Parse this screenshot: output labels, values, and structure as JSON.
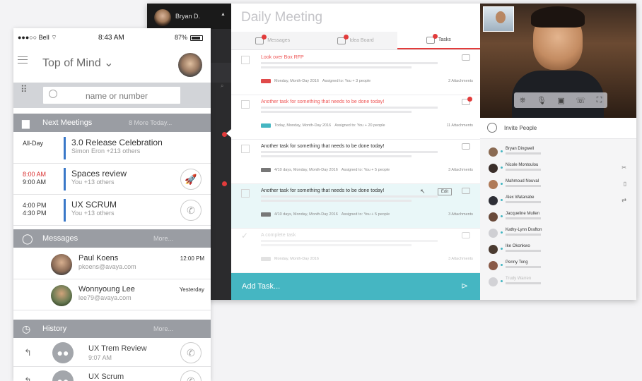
{
  "desktop": {
    "user": {
      "name": "Bryan D."
    },
    "title": "Daily Meeting",
    "tabs": [
      {
        "label": "Messages",
        "active": false
      },
      {
        "label": "Idea Board",
        "active": false
      },
      {
        "label": "Tasks",
        "active": true
      }
    ],
    "tasks": [
      {
        "title": "Look over Box RFP",
        "red": true,
        "meta": "Monday, Month-Day 2016",
        "assigned": "Assigned to: You + 3 people",
        "attachments": "2 Attachments"
      },
      {
        "title": "Another task for something that needs to be done today!",
        "red": true,
        "meta": "Today, Monday, Month-Day 2016",
        "assigned": "Assigned to: You + 20 people",
        "attachments": "11 Attachments"
      },
      {
        "title": "Another task for something that needs to be done today!",
        "red": false,
        "meta": "4/10 days, Monday, Month-Day 2016",
        "assigned": "Assigned to: You + 5 people",
        "attachments": "3 Attachments"
      },
      {
        "title": "Another task for something that needs to be done today!",
        "red": false,
        "meta": "4/10 days, Monday, Month-Day 2016",
        "assigned": "Assigned to: You + 5 people",
        "attachments": "3 Attachments",
        "edit_label": "Edit"
      },
      {
        "title": "A complete task",
        "red": false,
        "meta": "Monday, Month-Day 2016",
        "assigned": "",
        "attachments": "3 Attachments"
      }
    ],
    "add_task_label": "Add Task...",
    "invite_label": "Invite People",
    "participants": [
      {
        "name": "Bryan Dingwell",
        "color": "#8a6a52",
        "icon": ""
      },
      {
        "name": "Nicole Montoulou",
        "color": "#3a2e2a",
        "icon": "✂"
      },
      {
        "name": "Mahmoud Nouval",
        "color": "#b07a58",
        "icon": "▯"
      },
      {
        "name": "Alex Watanabe",
        "color": "#2f2f36",
        "icon": "⇄"
      },
      {
        "name": "Jacqueline Mullen",
        "color": "#6a4a3a",
        "icon": ""
      },
      {
        "name": "Kathy-Lynn Drafton",
        "color": "#cfcfd3",
        "icon": ""
      },
      {
        "name": "Ike Okonkwo",
        "color": "#4a3a30",
        "icon": ""
      },
      {
        "name": "Penny Tong",
        "color": "#8a5a48",
        "icon": ""
      },
      {
        "name": "Trudy Warren",
        "color": "#d2d2d6",
        "icon": ""
      }
    ],
    "video_controls": [
      "⎈",
      "🎙",
      "▣",
      "☏",
      "⛶"
    ]
  },
  "phone": {
    "status": {
      "carrier": "●●●○○ Bell ⌔",
      "time": "8:43 AM",
      "battery": "87%"
    },
    "title": "Top of Mind ⌄",
    "search_placeholder": "name or number",
    "dialpad_glyph": "⠿",
    "next_meetings": {
      "label": "Next Meetings",
      "more": "8 More Today..."
    },
    "meetings": [
      {
        "time1": "All-Day",
        "time2": "",
        "time1_red": false,
        "title": "3.0 Release Celebration",
        "sub": "Simon Eron +213 others",
        "action_icon": ""
      },
      {
        "time1": "8:00 AM",
        "time2": "9:00 AM",
        "time1_red": true,
        "title": "Spaces review",
        "sub": "You +13 others",
        "action_icon": "🚀"
      },
      {
        "time1": "4:00 PM",
        "time2": "4:30 PM",
        "time1_red": false,
        "title": "UX SCRUM",
        "sub": "You +13 others",
        "action_icon": "✆"
      }
    ],
    "messages_section": {
      "label": "Messages",
      "more": "More..."
    },
    "messages": [
      {
        "name": "Paul Koens",
        "email": "pkoens@avaya.com",
        "time": "12:00 PM",
        "avatar_color": "#b58a6c"
      },
      {
        "name": "Wonnyoung Lee",
        "email": "lee79@avaya.com",
        "time": "Yesterday",
        "avatar_color": "#6a7a52"
      }
    ],
    "history_section": {
      "label": "History",
      "more": "More..."
    },
    "history": [
      {
        "title": "UX Trem Review",
        "time": "9:07 AM",
        "icon": "↰"
      },
      {
        "title": "UX Scrum",
        "time": "",
        "icon": "↰"
      }
    ]
  }
}
